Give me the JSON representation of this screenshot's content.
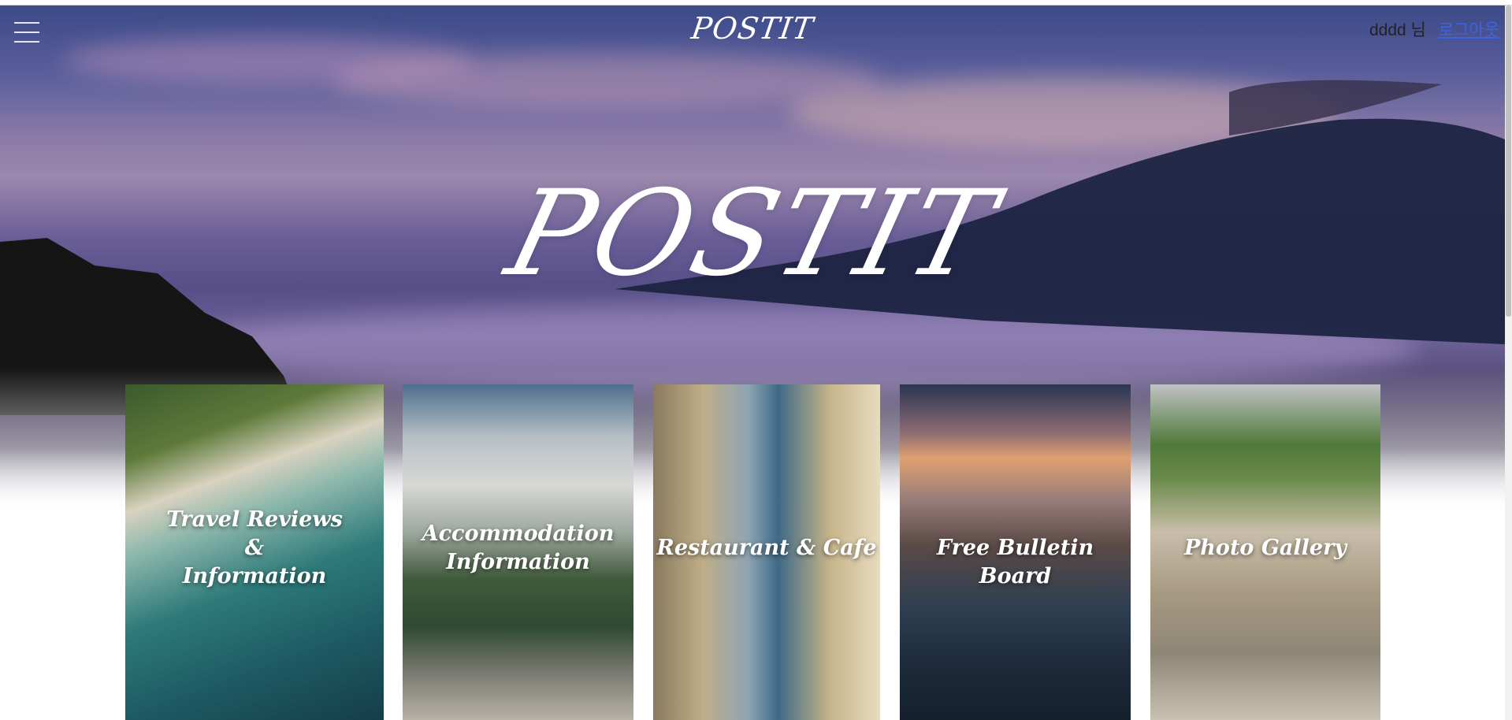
{
  "header": {
    "logo_small": "POSTIT",
    "user_text": "dddd 님",
    "logout_label": "로그아웃"
  },
  "hero": {
    "logo_large": "POSTIT"
  },
  "cards": [
    {
      "label_lines": [
        "Travel Reviews",
        "&",
        "Information"
      ]
    },
    {
      "label_lines": [
        "Accommodation",
        "Information"
      ]
    },
    {
      "label_lines": [
        "Restaurant & Cafe"
      ]
    },
    {
      "label_lines": [
        "Free Bulletin Board"
      ]
    },
    {
      "label_lines": [
        "Photo Gallery"
      ]
    }
  ],
  "colors": {
    "link": "#3f63e0",
    "hero_sky": "#5b5f9c",
    "text": "#222222"
  },
  "icons": {
    "menu": "hamburger-menu-icon"
  }
}
